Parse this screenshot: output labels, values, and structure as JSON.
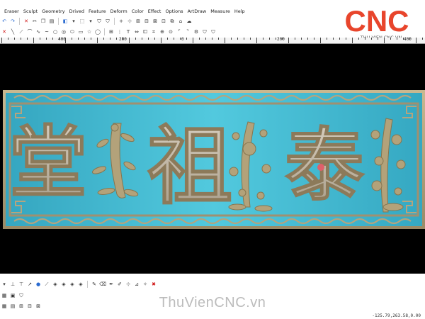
{
  "menu": [
    "Eraser",
    "Sculpt",
    "Geometry",
    "Drived",
    "Feature",
    "Deform",
    "Color",
    "Effect",
    "Options",
    "ArtDraw",
    "Measure",
    "Help"
  ],
  "ruler_labels": [
    "400",
    "200",
    "0",
    "200",
    "400"
  ],
  "logo": {
    "text": "CNC",
    "subtitle": "THU VIEN CNC.VN",
    "accent": "#e8452c"
  },
  "watermark": "ThuVienCNC.vn",
  "status_coords": "-125.79,263.58,0.00",
  "carving": {
    "characters": [
      "堂",
      "祖",
      "泰"
    ],
    "board_color": "#3fb7cf",
    "relief_color": "#b8aa8a"
  }
}
